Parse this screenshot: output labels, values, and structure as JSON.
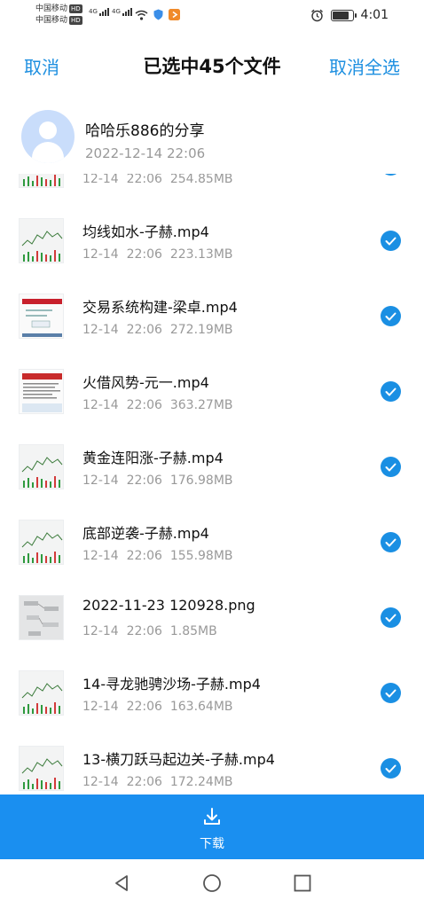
{
  "status_bar": {
    "carrier_1": "中国移动",
    "carrier_2": "中国移动",
    "hd_badge": "HD",
    "network_1": "4G",
    "network_2": "4G",
    "time": "4:01"
  },
  "header": {
    "cancel_label": "取消",
    "title": "已选中45个文件",
    "deselect_all_label": "取消全选"
  },
  "sharer": {
    "name": "哈哈乐886的分享",
    "time": "2022-12-14  22:06"
  },
  "files": [
    {
      "name": "",
      "time": "12-14  22:06",
      "size": "254.85MB",
      "thumb": "chart-icon"
    },
    {
      "name": "均线如水-子赫.mp4",
      "time": "12-14  22:06",
      "size": "223.13MB",
      "thumb": "chart-icon"
    },
    {
      "name": "交易系统构建-梁卓.mp4",
      "time": "12-14  22:06",
      "size": "272.19MB",
      "thumb": "slide-icon"
    },
    {
      "name": "火借风势-元一.mp4",
      "time": "12-14  22:06",
      "size": "363.27MB",
      "thumb": "document-icon"
    },
    {
      "name": "黄金连阳涨-子赫.mp4",
      "time": "12-14  22:06",
      "size": "176.98MB",
      "thumb": "chart-icon"
    },
    {
      "name": "底部逆袭-子赫.mp4",
      "time": "12-14  22:06",
      "size": "155.98MB",
      "thumb": "chart-icon"
    },
    {
      "name": "2022-11-23 120928.png",
      "time": "12-14  22:06",
      "size": "1.85MB",
      "thumb": "image-icon"
    },
    {
      "name": "14-寻龙驰骋沙场-子赫.mp4",
      "time": "12-14  22:06",
      "size": "163.64MB",
      "thumb": "chart-icon"
    },
    {
      "name": "13-横刀跃马起边关-子赫.mp4",
      "time": "12-14  22:06",
      "size": "172.24MB",
      "thumb": "chart-icon"
    }
  ],
  "download": {
    "label": "下载",
    "icon": "download-icon"
  },
  "colors": {
    "accent": "#1a8fe3",
    "download_bar": "#1a8ff0",
    "secondary_text": "#999999"
  }
}
